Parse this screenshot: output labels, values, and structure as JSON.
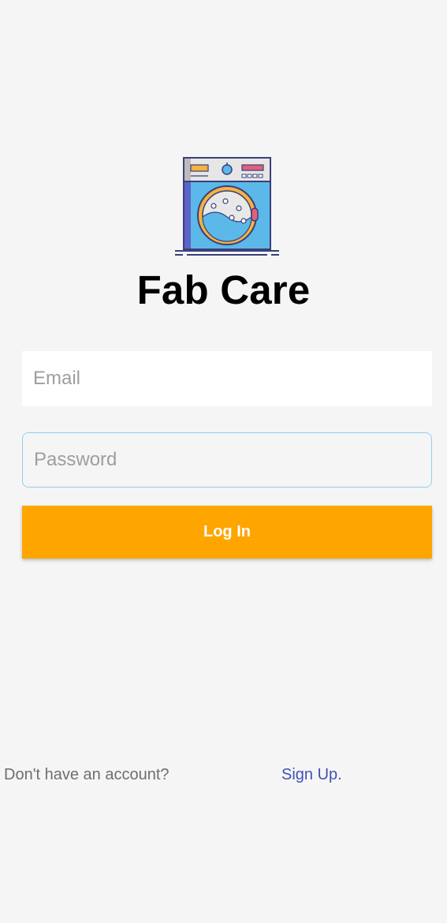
{
  "app": {
    "title": "Fab Care",
    "logo_icon": "washing-machine-icon"
  },
  "login_form": {
    "email_placeholder": "Email",
    "email_value": "",
    "password_placeholder": "Password",
    "password_value": "",
    "login_label": "Log In"
  },
  "footer": {
    "no_account_text": "Don't have an account?",
    "signup_label": "Sign Up."
  },
  "colors": {
    "background": "#f5f5f5",
    "accent": "#ffa500",
    "link": "#3f51b5",
    "focus_border": "#8fd0ee"
  }
}
